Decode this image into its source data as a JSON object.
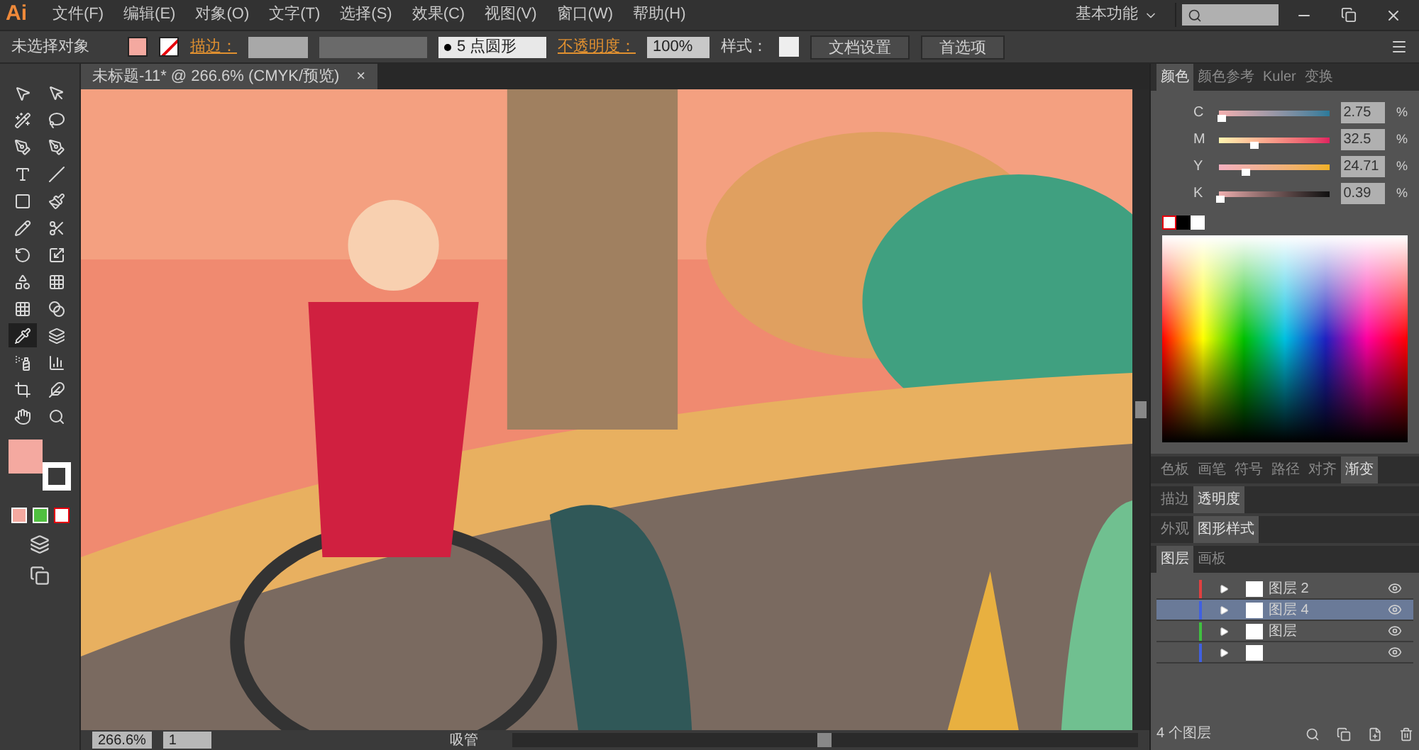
{
  "menu_bar": {
    "logo": "Ai",
    "menus": [
      "文件(F)",
      "编辑(E)",
      "对象(O)",
      "文字(T)",
      "选择(S)",
      "效果(C)",
      "视图(V)",
      "窗口(W)",
      "帮助(H)"
    ],
    "workspace": "基本功能"
  },
  "control_bar": {
    "selection": "未选择对象",
    "stroke_label": "描边：",
    "brush": "5 点圆形",
    "opacity_label": "不透明度：",
    "opacity": "100%",
    "style_label": "样式：",
    "buttons": [
      "文档设置",
      "首选项"
    ]
  },
  "document_tab": {
    "title": "未标题-11* @ 266.6% (CMYK/预览)",
    "close": "×"
  },
  "tools": [
    {
      "selected": false
    },
    {
      "selected": false
    },
    {
      "selected": false
    },
    {
      "selected": false
    },
    {
      "selected": false
    },
    {
      "selected": false
    },
    {
      "selected": false
    },
    {
      "selected": false
    },
    {
      "selected": false
    },
    {
      "selected": false
    },
    {
      "selected": false
    },
    {
      "selected": false
    },
    {
      "selected": false
    },
    {
      "selected": false
    },
    {
      "selected": false
    },
    {
      "selected": false
    },
    {
      "selected": false
    },
    {
      "selected": false
    },
    {
      "selected": true
    },
    {
      "selected": false
    },
    {
      "selected": false
    },
    {
      "selected": false
    },
    {
      "selected": false
    },
    {
      "selected": false
    },
    {
      "selected": false
    },
    {
      "selected": false
    }
  ],
  "color_panel": {
    "tabs": [
      {
        "label": "颜色",
        "selected": true
      },
      {
        "label": "颜色参考",
        "selected": false
      },
      {
        "label": "Kuler",
        "selected": false
      },
      {
        "label": "变换",
        "selected": false
      }
    ],
    "sliders": [
      {
        "name": "C",
        "level": 0.03,
        "value": "2.75",
        "unit": "%"
      },
      {
        "name": "M",
        "level": 0.33,
        "value": "32.5",
        "unit": "%"
      },
      {
        "name": "Y",
        "level": 0.25,
        "value": "24.71",
        "unit": "%"
      },
      {
        "name": "K",
        "level": 0.01,
        "value": "0.39",
        "unit": "%"
      }
    ]
  },
  "panel_groups": [
    {
      "tabs": [
        {
          "label": "色板",
          "selected": false
        },
        {
          "label": "画笔",
          "selected": false
        },
        {
          "label": "符号",
          "selected": false
        },
        {
          "label": "路径",
          "selected": false
        },
        {
          "label": "对齐",
          "selected": false
        },
        {
          "label": "渐变",
          "selected": true
        }
      ]
    },
    {
      "tabs": [
        {
          "label": "描边",
          "selected": false
        },
        {
          "label": "透明度",
          "selected": true
        }
      ]
    },
    {
      "tabs": [
        {
          "label": "外观",
          "selected": false
        },
        {
          "label": "图形样式",
          "selected": true
        }
      ]
    }
  ],
  "layers_panel": {
    "tabs": [
      {
        "label": "图层",
        "selected": true
      },
      {
        "label": "画板",
        "selected": false
      }
    ],
    "layers": [
      {
        "name": "图层 2",
        "color": "#e04040",
        "selected": false
      },
      {
        "name": "图层 4",
        "color": "#4060e0",
        "selected": true
      },
      {
        "name": "图层",
        "color": "#40c040",
        "selected": false
      },
      {
        "color": "#4060e0",
        "selected": false
      }
    ],
    "count": "4 个图层"
  },
  "status_bar": {
    "zoom": "266.6%",
    "artboard": "1",
    "tool": "吸管"
  }
}
